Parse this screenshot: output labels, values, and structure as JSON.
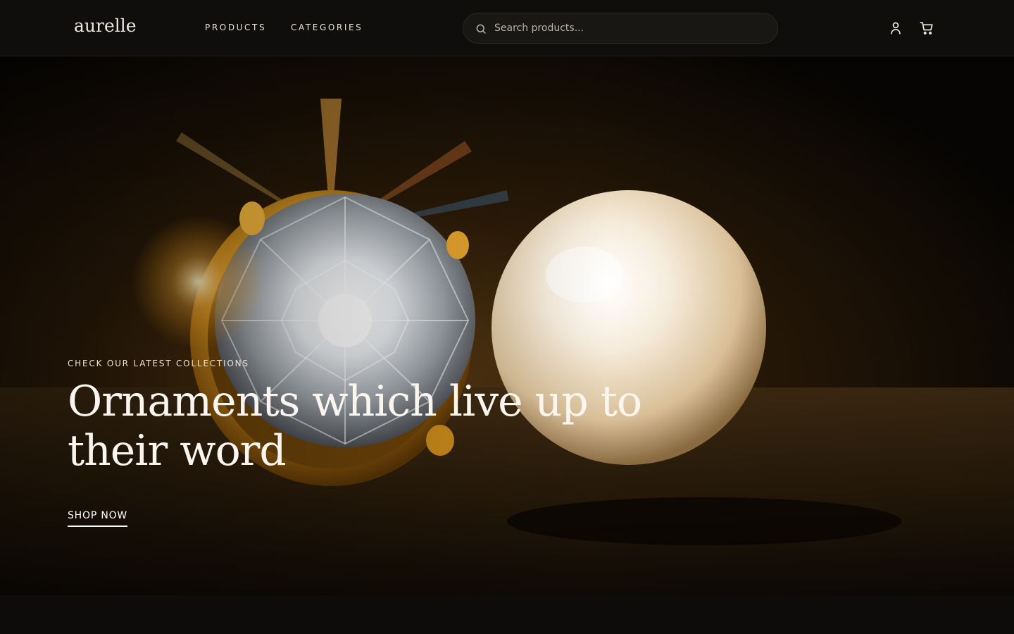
{
  "header": {
    "logo": "aurelle",
    "nav": [
      {
        "label": "PRODUCTS"
      },
      {
        "label": "CATEGORIES"
      }
    ],
    "search": {
      "placeholder": "Search products...",
      "value": "",
      "icon": "search-icon"
    },
    "actions": [
      {
        "icon": "user-icon"
      },
      {
        "icon": "cart-icon"
      }
    ]
  },
  "hero": {
    "eyebrow": "CHECK OUR LATEST COLLECTIONS",
    "title": "Ornaments which live up to their word",
    "cta_label": "SHOP NOW",
    "image": "diamond-ring-and-pearl"
  },
  "colors": {
    "background": "#0d0c0b",
    "header": "#0f0e0c",
    "gold": "#d9a02a",
    "text": "#f2ede4"
  }
}
